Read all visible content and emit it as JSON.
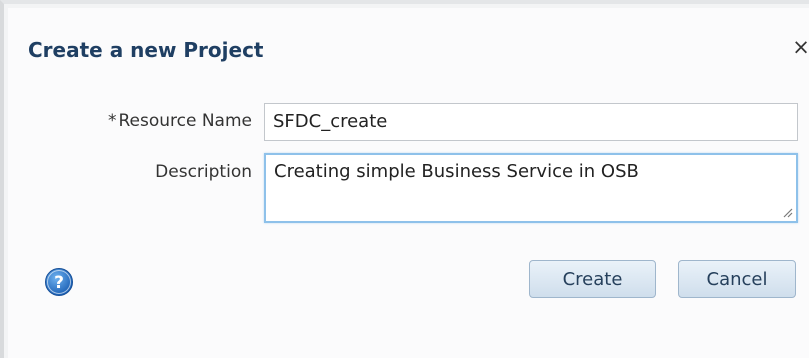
{
  "dialog": {
    "title": "Create a new Project",
    "close_symbol": "×",
    "close_icon": "close-icon"
  },
  "form": {
    "resource_name": {
      "required_marker": "*",
      "label": "Resource Name",
      "value": "SFDC_create"
    },
    "description": {
      "label": "Description",
      "value": "Creating simple Business Service in OSB"
    }
  },
  "footer": {
    "help_icon": "help-icon",
    "help_symbol": "?",
    "create_label": "Create",
    "cancel_label": "Cancel"
  },
  "colors": {
    "title": "#1f3f63",
    "focus_border": "#8ec1ea",
    "help_icon": "#2a6fc4",
    "button_text": "#26405c"
  }
}
